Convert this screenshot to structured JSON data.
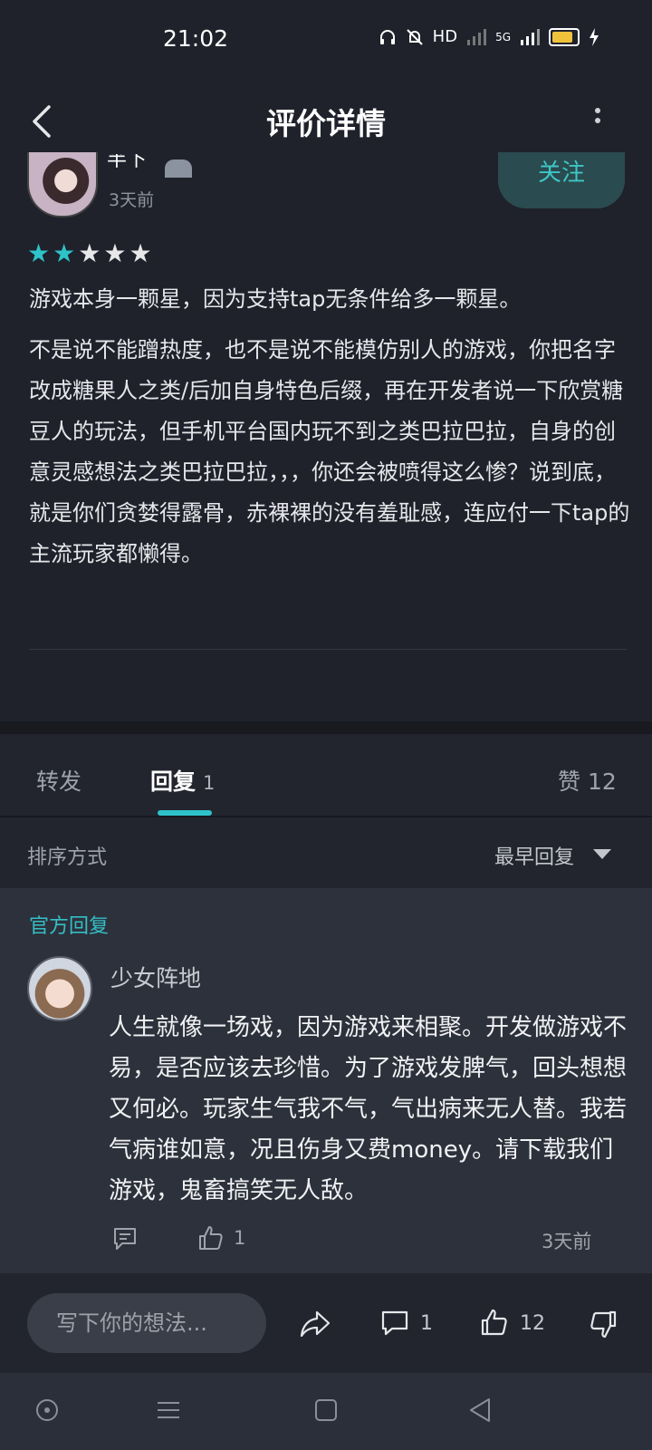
{
  "status_bar": {
    "time": "21:02",
    "network_label": "HD",
    "signal_label": "5G"
  },
  "header": {
    "title": "评价详情"
  },
  "post": {
    "author_name": "半下",
    "time": "3天前",
    "follow_label": "关注",
    "rating": 2,
    "rating_max": 5,
    "paragraph1": "游戏本身一颗星，因为支持tap无条件给多一颗星。",
    "paragraph2": "不是说不能蹭热度，也不是说不能模仿别人的游戏，你把名字改成糖果人之类/后加自身特色后缀，再在开发者说一下欣赏糖豆人的玩法，但手机平台国内玩不到之类巴拉巴拉，自身的创意灵感想法之类巴拉巴拉，，，你还会被喷得这么惨？说到底，就是你们贪婪得露骨，赤裸裸的没有羞耻感，连应付一下tap的主流玩家都懒得。"
  },
  "tabs": {
    "forward": "转发",
    "reply": "回复",
    "reply_count": "1",
    "likes": "赞 12"
  },
  "sort": {
    "label": "排序方式",
    "value": "最早回复"
  },
  "reply": {
    "official_label": "官方回复",
    "author": "少女阵地",
    "text": "人生就像一场戏，因为游戏来相聚。开发做游戏不易，是否应该去珍惜。为了游戏发脾气，回头想想又何必。玩家生气我不气，气出病来无人替。我若气病谁如意，况且伤身又费money。请下载我们游戏，鬼畜搞笑无人敌。",
    "like_count": "1",
    "time": "3天前"
  },
  "action_bar": {
    "input_placeholder": "写下你的想法...",
    "comment_count": "1",
    "like_count": "12"
  },
  "colors": {
    "accent": "#2ec3c8",
    "star_empty": "#e8e8ea",
    "background": "#1f222b",
    "card": "#2d313b"
  }
}
